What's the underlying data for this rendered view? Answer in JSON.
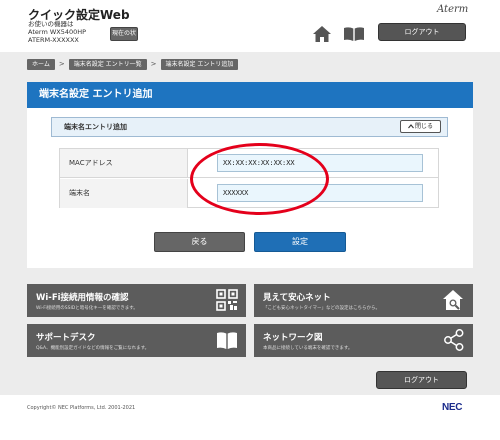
{
  "header": {
    "title": "クイック設定Web",
    "device_label": "お使いの機器は",
    "model": "Aterm WX5400HP",
    "device_id": "ATERM-XXXXXX",
    "status_button": "現在の状態",
    "brand": "Aterm",
    "logout": "ログアウト"
  },
  "breadcrumb": [
    "ホーム",
    "端末名設定 エントリ一覧",
    "端末名設定 エントリ追加"
  ],
  "breadcrumb_sep": ">",
  "section": {
    "title": "端末名設定 エントリ追加",
    "subtitle": "端末名エントリ追加",
    "close_button": "閉じる",
    "close_icon": "chevron-up-icon"
  },
  "form": {
    "mac_label": "MACアドレス",
    "mac_value": "XX:XX:XX:XX:XX:XX",
    "name_label": "端末名",
    "name_value": "XXXXXX"
  },
  "buttons": {
    "back": "戻る",
    "set": "設定"
  },
  "tiles": [
    {
      "title": "Wi-Fi接続用情報の確認",
      "desc": "Wi-Fi接続用のSSIDと暗号化キーを確認できます。",
      "icon": "qr-code-icon"
    },
    {
      "title": "見えて安心ネット",
      "desc": "「こども安心ネットタイマー」などの設定はこちらから。",
      "icon": "house-search-icon"
    },
    {
      "title": "サポートデスク",
      "desc": "Q&A、機能別設定ガイドなどの情報をご覧になれます。",
      "icon": "book-icon"
    },
    {
      "title": "ネットワーク図",
      "desc": "本商品に接続している端末を確認できます。",
      "icon": "network-icon"
    }
  ],
  "footer": {
    "logout": "ログアウト",
    "copyright": "Copyright© NEC Platforms, Ltd. 2001-2021",
    "logo": "NEC"
  },
  "colors": {
    "accent_blue": "#1e74c0",
    "highlight_red": "#e4001b",
    "dark_gray": "#5c5c5c"
  }
}
